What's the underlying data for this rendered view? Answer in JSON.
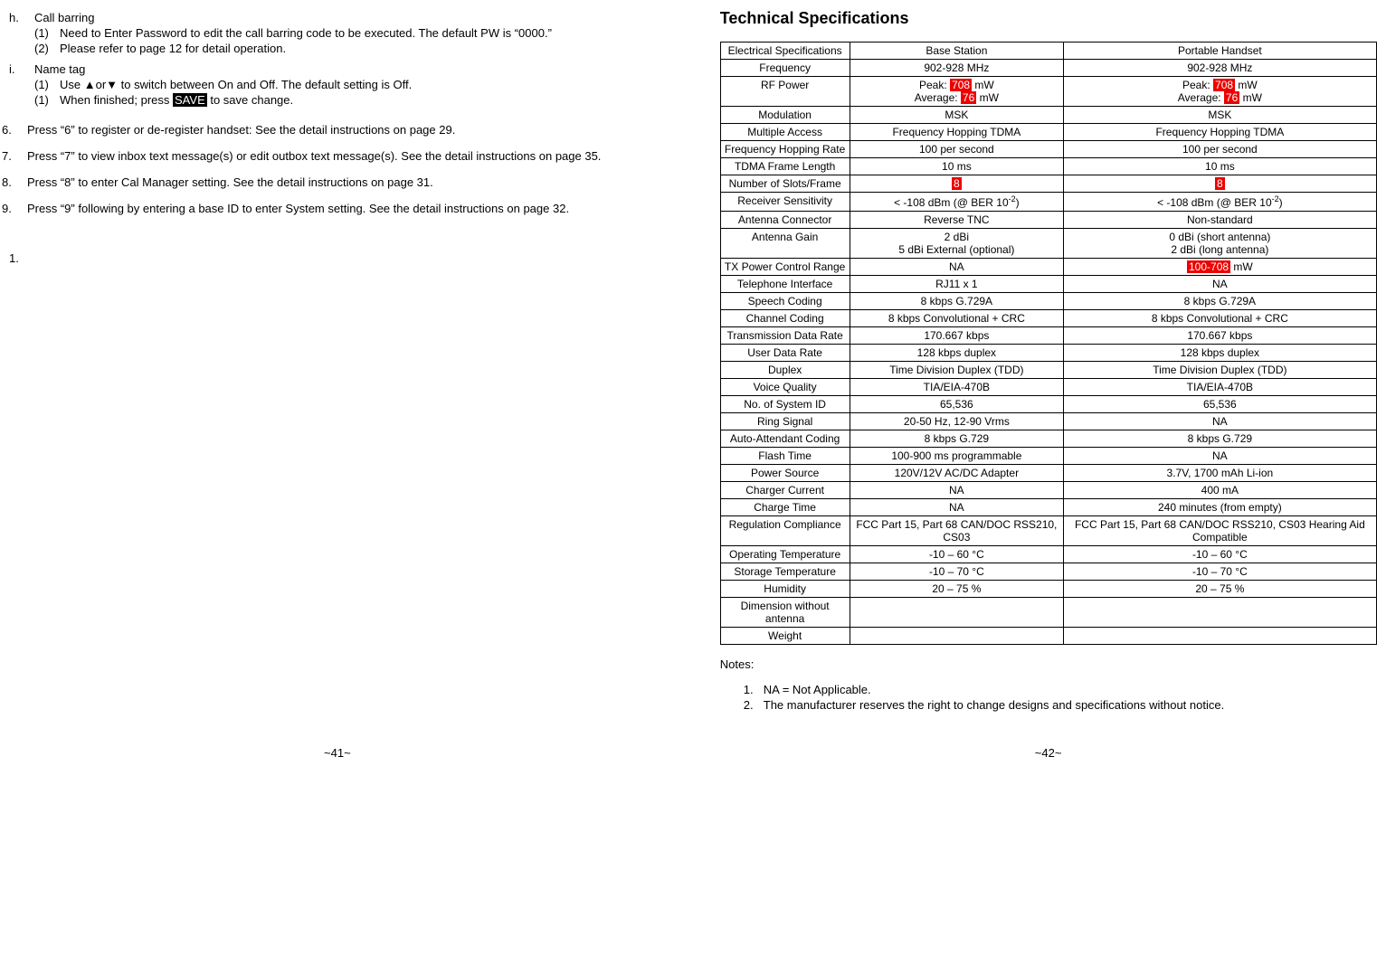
{
  "left": {
    "items": [
      {
        "letter": "h.",
        "title": "Call barring",
        "sub": [
          {
            "n": "(1)",
            "text": "Need to Enter Password to edit the call barring code to be executed. The default PW is “0000.”"
          },
          {
            "n": "(2)",
            "text": "Please refer to page 12 for detail operation."
          }
        ]
      },
      {
        "letter": "i.",
        "title": "Name tag",
        "sub": [
          {
            "n": "(1)",
            "pre": "Use ",
            "arrows": "▲or▼",
            "post": " to switch between On and Off.  The default setting is Off."
          },
          {
            "n": "(1)",
            "pre": "When finished; press ",
            "save": "SAVE",
            "post": " to save change."
          }
        ]
      }
    ],
    "numbered": [
      {
        "n": "6.",
        "text": "Press “6” to register or de-register handset:  See the detail instructions on page 29."
      },
      {
        "n": "7.",
        "text": "Press “7” to view inbox text message(s) or edit outbox text message(s). See the detail instructions on page 35."
      },
      {
        "n": "8.",
        "text": "Press “8” to enter Cal Manager setting. See the detail instructions on page 31."
      },
      {
        "n": "9.",
        "text": "Press “9” following by entering a base ID to enter System setting. See the detail instructions on page 32."
      }
    ],
    "lone": "1.",
    "pagenum": "~41~"
  },
  "right": {
    "title": "Technical Specifications",
    "header": {
      "c0": "Electrical Specifications",
      "c1": "Base Station",
      "c2": "Portable Handset"
    },
    "rows": [
      {
        "k": "Frequency",
        "a": "902-928 MHz",
        "b": "902-928 MHz"
      },
      {
        "k": "RF Power",
        "a_pre": "Peak: ",
        "a_r1": "708",
        "a_mid": " mW\nAverage: ",
        "a_r2": "76",
        "a_post": " mW",
        "b_pre": "Peak: ",
        "b_r1": "708",
        "b_mid": " mW\nAverage: ",
        "b_r2": "76",
        "b_post": " mW"
      },
      {
        "k": "Modulation",
        "a": "MSK",
        "b": "MSK"
      },
      {
        "k": "Multiple Access",
        "a": "Frequency Hopping TDMA",
        "b": "Frequency Hopping TDMA"
      },
      {
        "k": "Frequency Hopping Rate",
        "a": "100 per second",
        "b": "100 per second"
      },
      {
        "k": "TDMA Frame Length",
        "a": "10 ms",
        "b": "10 ms"
      },
      {
        "k": "Number of Slots/Frame",
        "a_r1": "8",
        "b_r1": "8"
      },
      {
        "k": "Receiver Sensitivity",
        "a_html": "< -108 dBm (@ BER 10<sup>-2</sup>)",
        "b_html": "< -108 dBm (@ BER 10<sup>-2</sup>)"
      },
      {
        "k": "Antenna Connector",
        "a": "Reverse TNC",
        "b": "Non-standard"
      },
      {
        "k": "Antenna Gain",
        "a": "2 dBi\n5 dBi External (optional)",
        "b": "0 dBi (short antenna)\n2 dBi (long antenna)"
      },
      {
        "k": "TX Power Control Range",
        "a": "NA",
        "b_r1": "100-708",
        "b_post": " mW"
      },
      {
        "k": "Telephone Interface",
        "a": "RJ11 x 1",
        "b": "NA"
      },
      {
        "k": "Speech Coding",
        "a": "8 kbps G.729A",
        "b": "8 kbps G.729A"
      },
      {
        "k": "Channel Coding",
        "a": "8 kbps Convolutional + CRC",
        "b": "8 kbps Convolutional + CRC"
      },
      {
        "k": "Transmission Data Rate",
        "a": "170.667 kbps",
        "b": "170.667 kbps"
      },
      {
        "k": "User Data Rate",
        "a": "128 kbps duplex",
        "b": "128 kbps duplex"
      },
      {
        "k": "Duplex",
        "a": "Time Division Duplex (TDD)",
        "b": "Time Division Duplex (TDD)"
      },
      {
        "k": "Voice Quality",
        "a": "TIA/EIA-470B",
        "b": "TIA/EIA-470B"
      },
      {
        "k": "No. of System ID",
        "a": "65,536",
        "b": "65,536"
      },
      {
        "k": "Ring Signal",
        "a": "20-50 Hz, 12-90 Vrms",
        "b": "NA"
      },
      {
        "k": "Auto-Attendant Coding",
        "a": "8 kbps G.729",
        "b": "8 kbps G.729"
      },
      {
        "k": "Flash Time",
        "a": "100-900 ms programmable",
        "b": "NA"
      },
      {
        "k": "Power Source",
        "a": "120V/12V AC/DC Adapter",
        "b": "3.7V, 1700 mAh Li-ion"
      },
      {
        "k": "Charger Current",
        "a": "NA",
        "b": "400 mA"
      },
      {
        "k": "Charge Time",
        "a": "NA",
        "b": "240 minutes (from empty)"
      },
      {
        "k": "Regulation Compliance",
        "a": "FCC Part 15, Part 68 CAN/DOC RSS210, CS03",
        "b": "FCC Part 15, Part 68 CAN/DOC RSS210, CS03 Hearing Aid Compatible"
      },
      {
        "k": "Operating Temperature",
        "a": "-10 – 60 °C",
        "b": "-10 – 60 °C"
      },
      {
        "k": "Storage Temperature",
        "a": "-10 – 70 °C",
        "b": "-10 – 70 °C"
      },
      {
        "k": "Humidity",
        "a": "20 – 75 %",
        "b": "20 – 75 %"
      },
      {
        "k": "Dimension without antenna",
        "a": "",
        "b": ""
      },
      {
        "k": "Weight",
        "a": "",
        "b": ""
      }
    ],
    "notes_title": "Notes:",
    "notes": [
      {
        "n": "1.",
        "text": "NA = Not Applicable."
      },
      {
        "n": "2.",
        "text": "The manufacturer reserves the right to change designs and specifications without notice."
      }
    ],
    "pagenum": "~42~"
  }
}
